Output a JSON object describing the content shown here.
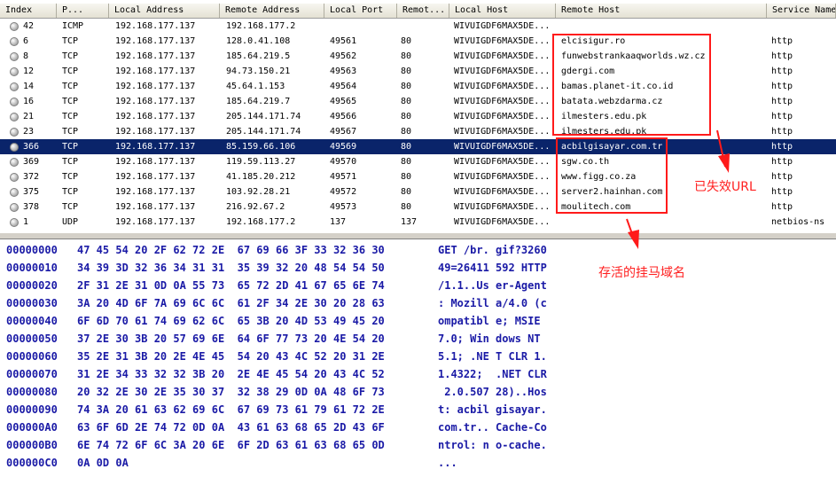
{
  "columns": [
    "Index",
    "P...",
    "Local Address",
    "Remote Address",
    "Local Port",
    "Remot...",
    "Local Host",
    "Remote Host",
    "Service Name"
  ],
  "rows": [
    {
      "index": "42",
      "proto": "ICMP",
      "laddr": "192.168.177.137",
      "raddr": "192.168.177.2",
      "lport": "",
      "rport": "",
      "lhost": "WIVUIGDF6MAX5DE...",
      "rhost": "",
      "svc": ""
    },
    {
      "index": "6",
      "proto": "TCP",
      "laddr": "192.168.177.137",
      "raddr": "128.0.41.108",
      "lport": "49561",
      "rport": "80",
      "lhost": "WIVUIGDF6MAX5DE...",
      "rhost": "elcisigur.ro",
      "svc": "http"
    },
    {
      "index": "8",
      "proto": "TCP",
      "laddr": "192.168.177.137",
      "raddr": "185.64.219.5",
      "lport": "49562",
      "rport": "80",
      "lhost": "WIVUIGDF6MAX5DE...",
      "rhost": "funwebstrankaaqworlds.wz.cz",
      "svc": "http"
    },
    {
      "index": "12",
      "proto": "TCP",
      "laddr": "192.168.177.137",
      "raddr": "94.73.150.21",
      "lport": "49563",
      "rport": "80",
      "lhost": "WIVUIGDF6MAX5DE...",
      "rhost": "gdergi.com",
      "svc": "http"
    },
    {
      "index": "14",
      "proto": "TCP",
      "laddr": "192.168.177.137",
      "raddr": "45.64.1.153",
      "lport": "49564",
      "rport": "80",
      "lhost": "WIVUIGDF6MAX5DE...",
      "rhost": "bamas.planet-it.co.id",
      "svc": "http"
    },
    {
      "index": "16",
      "proto": "TCP",
      "laddr": "192.168.177.137",
      "raddr": "185.64.219.7",
      "lport": "49565",
      "rport": "80",
      "lhost": "WIVUIGDF6MAX5DE...",
      "rhost": "batata.webzdarma.cz",
      "svc": "http"
    },
    {
      "index": "21",
      "proto": "TCP",
      "laddr": "192.168.177.137",
      "raddr": "205.144.171.74",
      "lport": "49566",
      "rport": "80",
      "lhost": "WIVUIGDF6MAX5DE...",
      "rhost": "ilmesters.edu.pk",
      "svc": "http"
    },
    {
      "index": "23",
      "proto": "TCP",
      "laddr": "192.168.177.137",
      "raddr": "205.144.171.74",
      "lport": "49567",
      "rport": "80",
      "lhost": "WIVUIGDF6MAX5DE...",
      "rhost": "ilmesters.edu.pk",
      "svc": "http"
    },
    {
      "index": "366",
      "proto": "TCP",
      "laddr": "192.168.177.137",
      "raddr": "85.159.66.106",
      "lport": "49569",
      "rport": "80",
      "lhost": "WIVUIGDF6MAX5DE...",
      "rhost": "acbilgisayar.com.tr",
      "svc": "http",
      "selected": true
    },
    {
      "index": "369",
      "proto": "TCP",
      "laddr": "192.168.177.137",
      "raddr": "119.59.113.27",
      "lport": "49570",
      "rport": "80",
      "lhost": "WIVUIGDF6MAX5DE...",
      "rhost": "sgw.co.th",
      "svc": "http"
    },
    {
      "index": "372",
      "proto": "TCP",
      "laddr": "192.168.177.137",
      "raddr": "41.185.20.212",
      "lport": "49571",
      "rport": "80",
      "lhost": "WIVUIGDF6MAX5DE...",
      "rhost": "www.figg.co.za",
      "svc": "http"
    },
    {
      "index": "375",
      "proto": "TCP",
      "laddr": "192.168.177.137",
      "raddr": "103.92.28.21",
      "lport": "49572",
      "rport": "80",
      "lhost": "WIVUIGDF6MAX5DE...",
      "rhost": "server2.hainhan.com",
      "svc": "http"
    },
    {
      "index": "378",
      "proto": "TCP",
      "laddr": "192.168.177.137",
      "raddr": "216.92.67.2",
      "lport": "49573",
      "rport": "80",
      "lhost": "WIVUIGDF6MAX5DE...",
      "rhost": "moulitech.com",
      "svc": "http"
    },
    {
      "index": "1",
      "proto": "UDP",
      "laddr": "192.168.177.137",
      "raddr": "192.168.177.2",
      "lport": "137",
      "rport": "137",
      "lhost": "WIVUIGDF6MAX5DE...",
      "rhost": "",
      "svc": "netbios-ns"
    }
  ],
  "hex": [
    {
      "off": "00000000",
      "bytes": "47 45 54 20 2F 62 72 2E  67 69 66 3F 33 32 36 30",
      "ascii": "GET /br. gif?3260"
    },
    {
      "off": "00000010",
      "bytes": "34 39 3D 32 36 34 31 31  35 39 32 20 48 54 54 50",
      "ascii": "49=26411 592 HTTP"
    },
    {
      "off": "00000020",
      "bytes": "2F 31 2E 31 0D 0A 55 73  65 72 2D 41 67 65 6E 74",
      "ascii": "/1.1..Us er-Agent"
    },
    {
      "off": "00000030",
      "bytes": "3A 20 4D 6F 7A 69 6C 6C  61 2F 34 2E 30 20 28 63",
      "ascii": ": Mozill a/4.0 (c"
    },
    {
      "off": "00000040",
      "bytes": "6F 6D 70 61 74 69 62 6C  65 3B 20 4D 53 49 45 20",
      "ascii": "ompatibl e; MSIE "
    },
    {
      "off": "00000050",
      "bytes": "37 2E 30 3B 20 57 69 6E  64 6F 77 73 20 4E 54 20",
      "ascii": "7.0; Win dows NT "
    },
    {
      "off": "00000060",
      "bytes": "35 2E 31 3B 20 2E 4E 45  54 20 43 4C 52 20 31 2E",
      "ascii": "5.1; .NE T CLR 1."
    },
    {
      "off": "00000070",
      "bytes": "31 2E 34 33 32 32 3B 20  2E 4E 45 54 20 43 4C 52",
      "ascii": "1.4322;  .NET CLR"
    },
    {
      "off": "00000080",
      "bytes": "20 32 2E 30 2E 35 30 37  32 38 29 0D 0A 48 6F 73",
      "ascii": " 2.0.507 28)..Hos"
    },
    {
      "off": "00000090",
      "bytes": "74 3A 20 61 63 62 69 6C  67 69 73 61 79 61 72 2E",
      "ascii": "t: acbil gisayar."
    },
    {
      "off": "000000A0",
      "bytes": "63 6F 6D 2E 74 72 0D 0A  43 61 63 68 65 2D 43 6F",
      "ascii": "com.tr.. Cache-Co"
    },
    {
      "off": "000000B0",
      "bytes": "6E 74 72 6F 6C 3A 20 6E  6F 2D 63 61 63 68 65 0D",
      "ascii": "ntrol: n o-cache."
    },
    {
      "off": "000000C0",
      "bytes": "0A 0D 0A",
      "ascii": "..."
    }
  ],
  "annotations": {
    "dead_url": "已失效URL",
    "live_domain": "存活的挂马域名"
  },
  "colors": {
    "annotation": "#ff2020",
    "selection": "#0a246a",
    "hex_text": "#1a1aa6"
  }
}
